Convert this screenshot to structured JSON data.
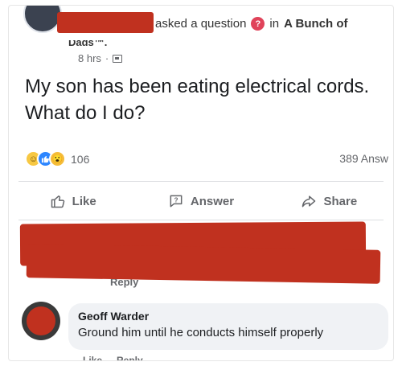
{
  "post": {
    "header_action": "asked a question",
    "in_label": "in",
    "group": "A Bunch of",
    "group_continuation": "Dads™.",
    "time": "8 hrs",
    "separator": "·",
    "question": "My son has been eating electrical cords. What do I do?",
    "reaction_count": "106",
    "answers_count": "389 Answ"
  },
  "actions": {
    "like": "Like",
    "answer": "Answer",
    "share": "Share"
  },
  "comments": [
    {
      "reply_label": "Reply"
    },
    {
      "author": "Geoff Warder",
      "text": "Ground him until he conducts himself properly",
      "like_label": "Like",
      "reply_label": "Reply"
    }
  ],
  "colors": {
    "redaction": "#c0311f",
    "question_badge": "#e0435a",
    "like_reaction": "#2d86ff"
  },
  "icons": [
    "question-icon",
    "group-privacy-icon",
    "haha-reaction-icon",
    "like-reaction-icon",
    "wow-reaction-icon",
    "thumbs-up-icon",
    "answer-icon",
    "share-icon"
  ]
}
